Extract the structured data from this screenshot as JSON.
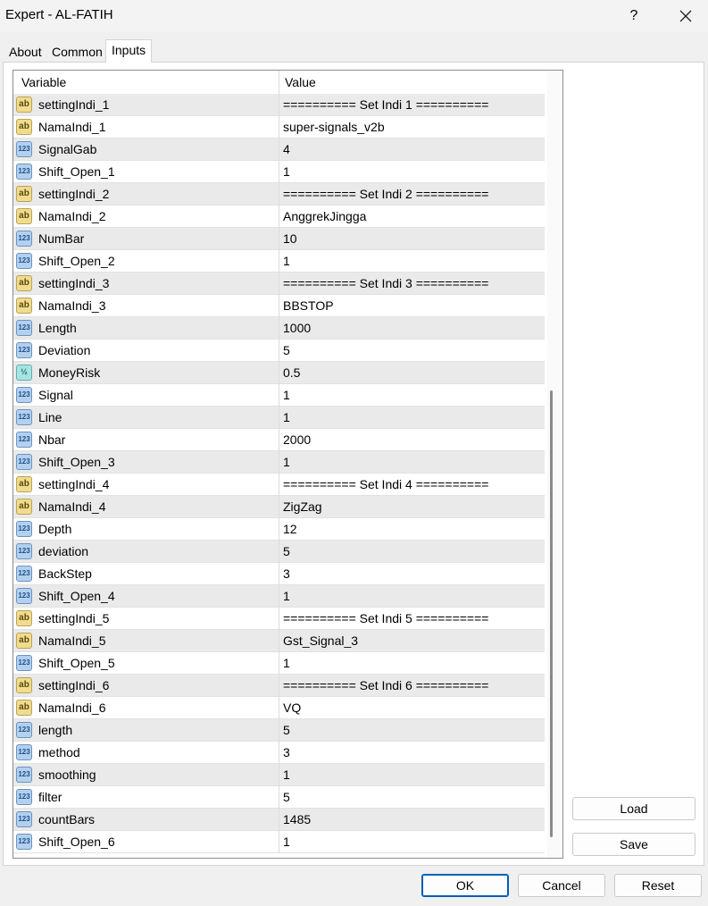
{
  "window": {
    "title": "Expert - AL-FATIH",
    "help_label": "?"
  },
  "tabs": [
    {
      "label": "About",
      "active": false
    },
    {
      "label": "Common",
      "active": false
    },
    {
      "label": "Inputs",
      "active": true
    }
  ],
  "grid": {
    "headers": {
      "variable": "Variable",
      "value": "Value"
    },
    "rows": [
      {
        "type": "string",
        "icon": "ab",
        "variable": "settingIndi_1",
        "value": "========== Set Indi 1 =========="
      },
      {
        "type": "string",
        "icon": "ab",
        "variable": "NamaIndi_1",
        "value": "super-signals_v2b"
      },
      {
        "type": "int",
        "icon": "123",
        "variable": "SignalGab",
        "value": "4"
      },
      {
        "type": "int",
        "icon": "123",
        "variable": "Shift_Open_1",
        "value": "1"
      },
      {
        "type": "string",
        "icon": "ab",
        "variable": "settingIndi_2",
        "value": "========== Set Indi 2 =========="
      },
      {
        "type": "string",
        "icon": "ab",
        "variable": "NamaIndi_2",
        "value": "AnggrekJingga"
      },
      {
        "type": "int",
        "icon": "123",
        "variable": "NumBar",
        "value": "10"
      },
      {
        "type": "int",
        "icon": "123",
        "variable": "Shift_Open_2",
        "value": "1"
      },
      {
        "type": "string",
        "icon": "ab",
        "variable": "settingIndi_3",
        "value": "========== Set Indi 3 =========="
      },
      {
        "type": "string",
        "icon": "ab",
        "variable": "NamaIndi_3",
        "value": "BBSTOP"
      },
      {
        "type": "int",
        "icon": "123",
        "variable": "Length",
        "value": "1000"
      },
      {
        "type": "int",
        "icon": "123",
        "variable": "Deviation",
        "value": "5"
      },
      {
        "type": "double",
        "icon": "½",
        "variable": "MoneyRisk",
        "value": "0.5"
      },
      {
        "type": "int",
        "icon": "123",
        "variable": "Signal",
        "value": "1"
      },
      {
        "type": "int",
        "icon": "123",
        "variable": "Line",
        "value": "1"
      },
      {
        "type": "int",
        "icon": "123",
        "variable": "Nbar",
        "value": "2000"
      },
      {
        "type": "int",
        "icon": "123",
        "variable": "Shift_Open_3",
        "value": "1"
      },
      {
        "type": "string",
        "icon": "ab",
        "variable": "settingIndi_4",
        "value": "========== Set Indi 4 =========="
      },
      {
        "type": "string",
        "icon": "ab",
        "variable": "NamaIndi_4",
        "value": "ZigZag"
      },
      {
        "type": "int",
        "icon": "123",
        "variable": "Depth",
        "value": "12"
      },
      {
        "type": "int",
        "icon": "123",
        "variable": "deviation",
        "value": "5"
      },
      {
        "type": "int",
        "icon": "123",
        "variable": "BackStep",
        "value": "3"
      },
      {
        "type": "int",
        "icon": "123",
        "variable": "Shift_Open_4",
        "value": "1"
      },
      {
        "type": "string",
        "icon": "ab",
        "variable": "settingIndi_5",
        "value": "========== Set Indi 5 =========="
      },
      {
        "type": "string",
        "icon": "ab",
        "variable": "NamaIndi_5",
        "value": "Gst_Signal_3"
      },
      {
        "type": "int",
        "icon": "123",
        "variable": "Shift_Open_5",
        "value": "1"
      },
      {
        "type": "string",
        "icon": "ab",
        "variable": "settingIndi_6",
        "value": "========== Set Indi 6 =========="
      },
      {
        "type": "string",
        "icon": "ab",
        "variable": "NamaIndi_6",
        "value": "VQ"
      },
      {
        "type": "int",
        "icon": "123",
        "variable": "length",
        "value": "5"
      },
      {
        "type": "int",
        "icon": "123",
        "variable": "method",
        "value": "3"
      },
      {
        "type": "int",
        "icon": "123",
        "variable": "smoothing",
        "value": "1"
      },
      {
        "type": "int",
        "icon": "123",
        "variable": "filter",
        "value": "5"
      },
      {
        "type": "int",
        "icon": "123",
        "variable": "countBars",
        "value": "1485"
      },
      {
        "type": "int",
        "icon": "123",
        "variable": "Shift_Open_6",
        "value": "1"
      }
    ]
  },
  "side_buttons": {
    "load": "Load",
    "save": "Save"
  },
  "footer_buttons": {
    "ok": "OK",
    "cancel": "Cancel",
    "reset": "Reset"
  },
  "colors": {
    "accent": "#005fb8",
    "string_icon": "#f1dc8d",
    "int_icon": "#b3d0ee",
    "double_icon": "#a9e3e2"
  }
}
